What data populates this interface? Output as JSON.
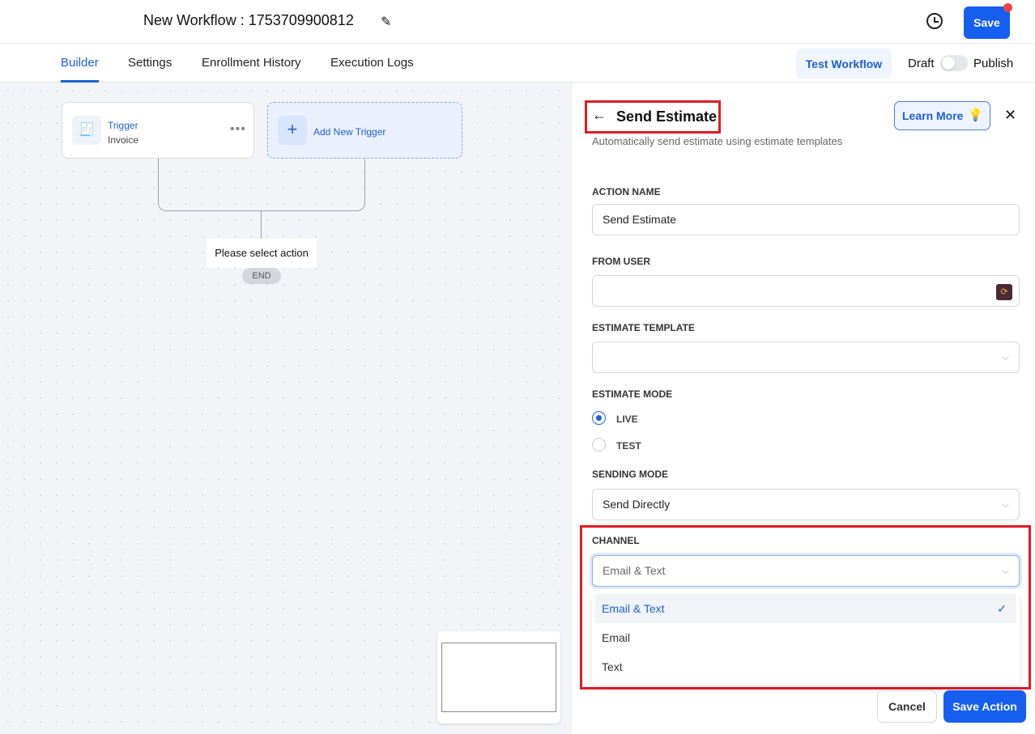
{
  "header": {
    "title": "New Workflow : 1753709900812",
    "save_label": "Save"
  },
  "tabs": [
    {
      "label": "Builder"
    },
    {
      "label": "Settings"
    },
    {
      "label": "Enrollment History"
    },
    {
      "label": "Execution Logs"
    }
  ],
  "toolbar": {
    "test_workflow": "Test Workflow",
    "draft": "Draft",
    "publish": "Publish"
  },
  "canvas": {
    "trigger_title": "Trigger",
    "trigger_sub": "Invoice",
    "add_trigger": "Add New Trigger",
    "select_action": "Please select action",
    "end": "END"
  },
  "panel": {
    "title": "Send Estimate",
    "learn_more": "Learn More",
    "description": "Automatically send estimate using estimate templates",
    "action_name_label": "ACTION NAME",
    "action_name_value": "Send Estimate",
    "from_user_label": "FROM USER",
    "from_user_value": "",
    "template_label": "ESTIMATE TEMPLATE",
    "template_value": "",
    "mode_label": "ESTIMATE MODE",
    "mode_options": [
      "LIVE",
      "TEST"
    ],
    "mode_selected": "LIVE",
    "sending_label": "SENDING MODE",
    "sending_value": "Send Directly",
    "channel_label": "CHANNEL",
    "channel_value": "Email & Text",
    "channel_options": [
      "Email & Text",
      "Email",
      "Text"
    ],
    "cancel": "Cancel",
    "save_action": "Save Action"
  }
}
